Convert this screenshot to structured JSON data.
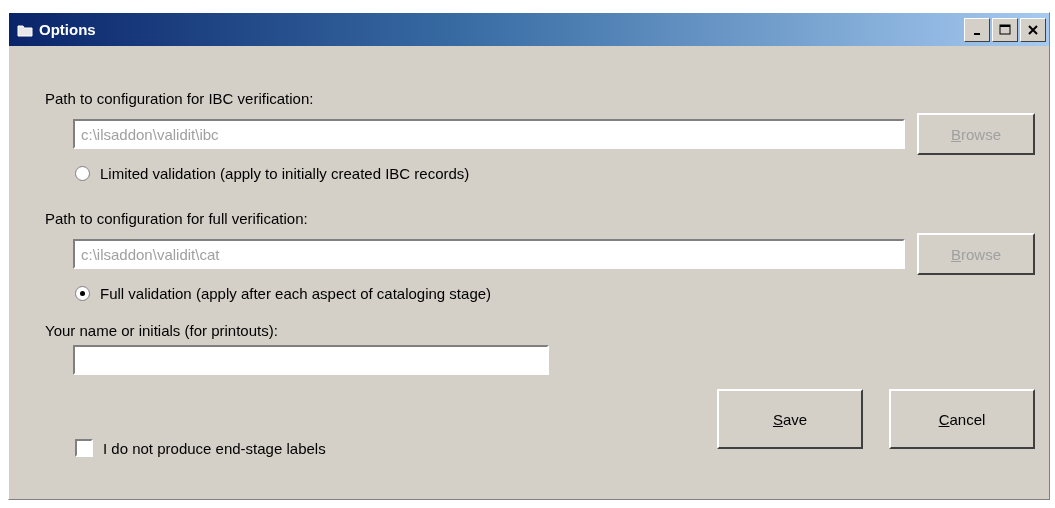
{
  "window": {
    "title": "Options"
  },
  "sections": [
    {
      "label": "Path to configuration for IBC verification:",
      "path": {
        "value": "c:\\ilsaddon\\validit\\ibc",
        "disabled": true
      },
      "browse": {
        "label": "Browse",
        "disabled": true
      },
      "option": {
        "label": "Limited validation (apply to initially created IBC records)",
        "selected": false
      }
    },
    {
      "label": "Path to configuration for full verification:",
      "path": {
        "value": "c:\\ilsaddon\\validit\\cat",
        "disabled": true
      },
      "browse": {
        "label": "Browse",
        "disabled": true
      },
      "option": {
        "label": "Full validation (apply after each aspect of cataloging stage)",
        "selected": true
      }
    }
  ],
  "name_field": {
    "label": "Your name or initials (for printouts):"
  },
  "checkbox": {
    "label": "I do not produce end-stage labels",
    "checked": false
  },
  "buttons": [
    {
      "label": "Save"
    },
    {
      "label": "Cancel"
    }
  ]
}
